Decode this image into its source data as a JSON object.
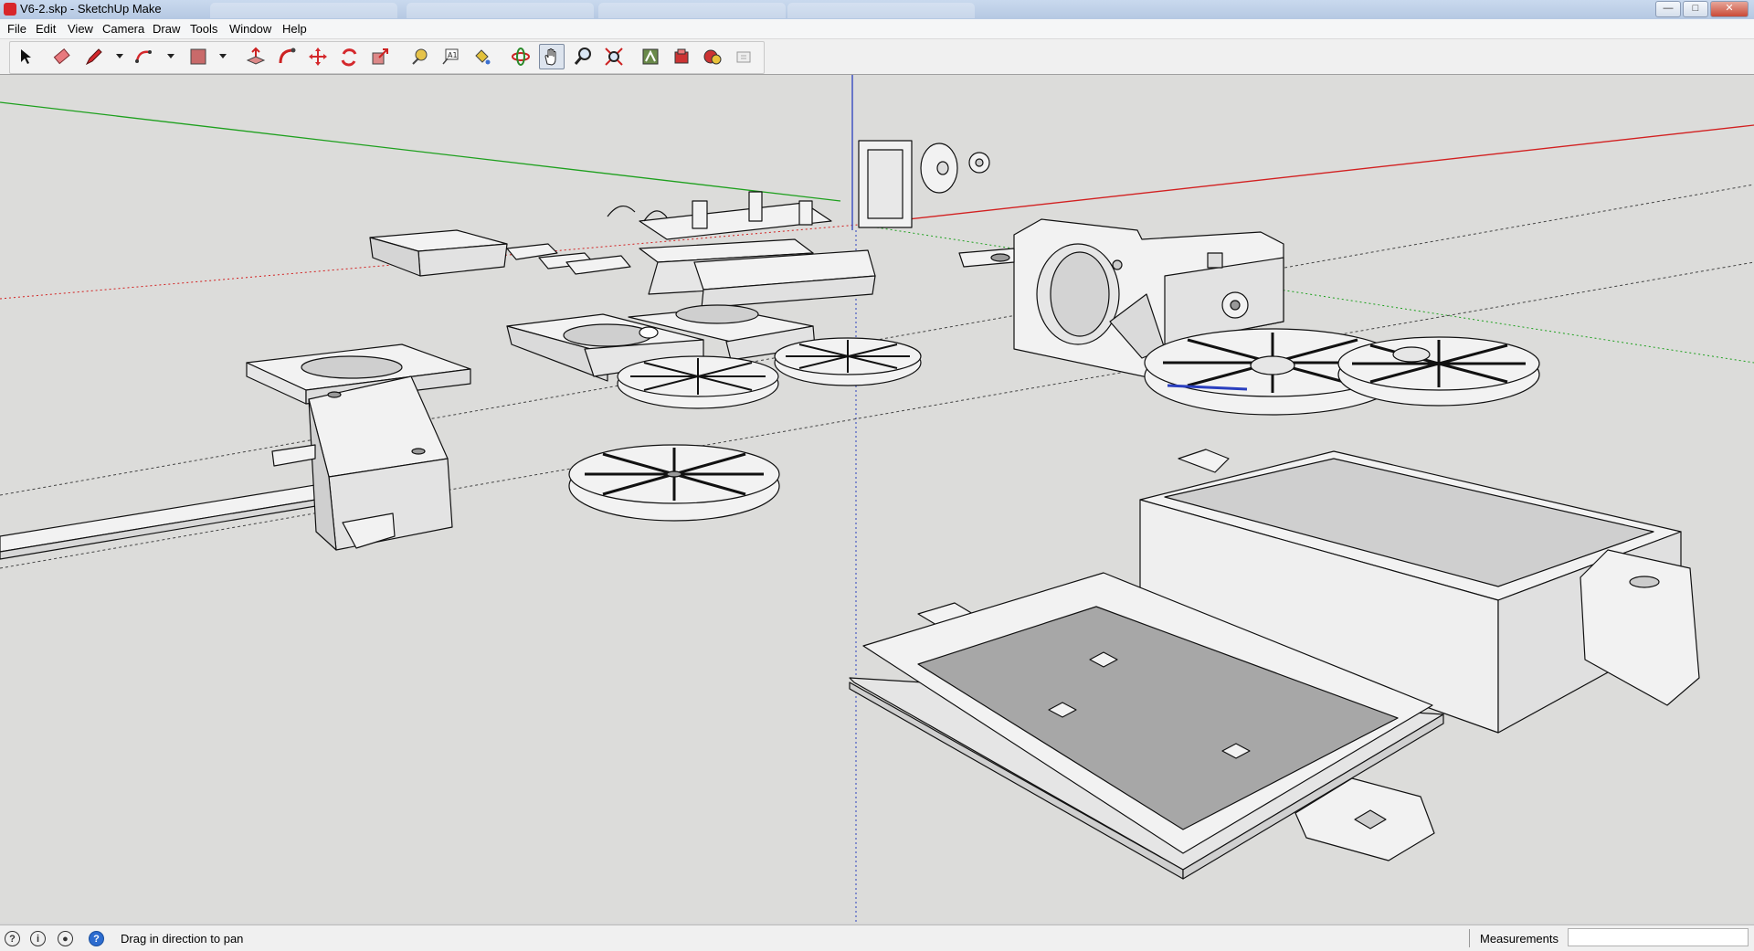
{
  "window": {
    "title": "V6-2.skp - SketchUp Make",
    "background_tabs": [
      "",
      "",
      "",
      ""
    ]
  },
  "menu": {
    "items": [
      {
        "label": "File"
      },
      {
        "label": "Edit"
      },
      {
        "label": "View"
      },
      {
        "label": "Camera"
      },
      {
        "label": "Draw"
      },
      {
        "label": "Tools"
      },
      {
        "label": "Window"
      },
      {
        "label": "Help"
      }
    ]
  },
  "toolbar": {
    "tools": [
      "select-icon",
      "eraser-icon",
      "pencil-icon",
      "arc-icon",
      "rectangle-icon",
      "push-pull-icon",
      "follow-me-icon",
      "move-icon",
      "rotate-icon",
      "scale-icon",
      "tape-measure-icon",
      "text-icon",
      "paint-bucket-icon",
      "orbit-icon",
      "pan-icon",
      "zoom-icon",
      "zoom-extents-icon",
      "3d-warehouse-icon",
      "extension-warehouse-icon",
      "layout-icon",
      "send-to-layout-icon"
    ],
    "active_tool": "pan-icon"
  },
  "status": {
    "hint": "Drag in direction to pan",
    "measurements_label": "Measurements",
    "measurements_value": ""
  },
  "colors": {
    "viewport_bg": "#dcdcda",
    "axis_red": "#d22020",
    "axis_green": "#1ea01e",
    "axis_blue": "#2a3fbf",
    "face": "#f2f2f2",
    "face_shadow": "#a7a7a7"
  }
}
